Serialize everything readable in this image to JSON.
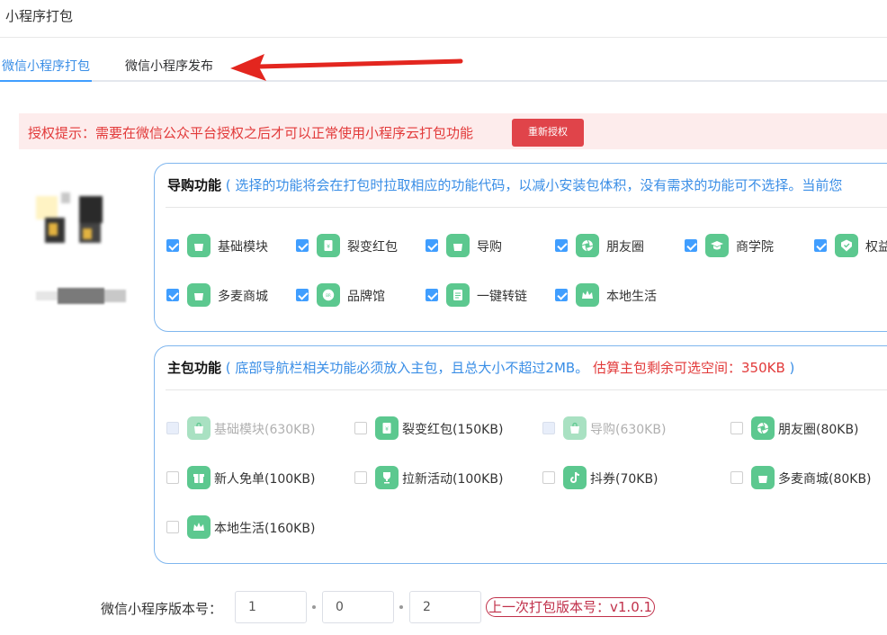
{
  "page_title": "小程序打包",
  "tabs": [
    {
      "label": "微信小程序打包",
      "active": true
    },
    {
      "label": "微信小程序发布",
      "active": false
    }
  ],
  "auth": {
    "text": "授权提示：需要在微信公众平台授权之后才可以正常使用小程序云打包功能",
    "button": "重新授权"
  },
  "guide": {
    "title": "导购功能",
    "desc": "( 选择的功能将会在打包时拉取相应的功能代码，以减小安装包体积，没有需求的功能可不选择。当前您",
    "items": [
      {
        "label": "基础模块",
        "icon": "shopping-bag-icon",
        "checked": true
      },
      {
        "label": "裂变红包",
        "icon": "red-envelope-icon",
        "checked": true
      },
      {
        "label": "导购",
        "icon": "shopping-bag-icon",
        "checked": true
      },
      {
        "label": "朋友圈",
        "icon": "aperture-icon",
        "checked": true
      },
      {
        "label": "商学院",
        "icon": "graduation-cap-icon",
        "checked": true
      },
      {
        "label": "权益",
        "icon": "badge-icon",
        "checked": true
      },
      {
        "label": "多麦商城",
        "icon": "shopping-bag-icon",
        "checked": true
      },
      {
        "label": "品牌馆",
        "icon": "brand-icon",
        "checked": true
      },
      {
        "label": "一键转链",
        "icon": "document-icon",
        "checked": true
      },
      {
        "label": "本地生活",
        "icon": "crown-icon",
        "checked": true
      }
    ]
  },
  "main_pkg": {
    "title": "主包功能",
    "desc": "( 底部导航栏相关功能必须放入主包，且总大小不超过2MB。",
    "warn": "估算主包剩余可选空间：350KB",
    "close": ")",
    "items": [
      {
        "label": "基础模块(630KB)",
        "icon": "shopping-bag-icon",
        "state": "disabled"
      },
      {
        "label": "裂变红包(150KB)",
        "icon": "red-envelope-icon",
        "state": "unchecked"
      },
      {
        "label": "导购(630KB)",
        "icon": "shopping-bag-icon",
        "state": "disabled"
      },
      {
        "label": "朋友圈(80KB)",
        "icon": "aperture-icon",
        "state": "unchecked"
      },
      {
        "label": "新人免单(100KB)",
        "icon": "gift-icon",
        "state": "unchecked"
      },
      {
        "label": "拉新活动(100KB)",
        "icon": "trophy-icon",
        "state": "unchecked"
      },
      {
        "label": "抖券(70KB)",
        "icon": "tiktok-icon",
        "state": "unchecked"
      },
      {
        "label": "多麦商城(80KB)",
        "icon": "shopping-bag-icon",
        "state": "unchecked"
      },
      {
        "label": "本地生活(160KB)",
        "icon": "crown-icon",
        "state": "unchecked"
      }
    ]
  },
  "version": {
    "label": "微信小程序版本号：",
    "major": "1",
    "minor": "0",
    "patch": "2",
    "last": "上一次打包版本号：v1.0.1"
  },
  "colors": {
    "accent": "#409eff",
    "icon_green": "#5cc88f",
    "alert_red": "#e23a3a",
    "arrow_red": "#e3261f"
  }
}
